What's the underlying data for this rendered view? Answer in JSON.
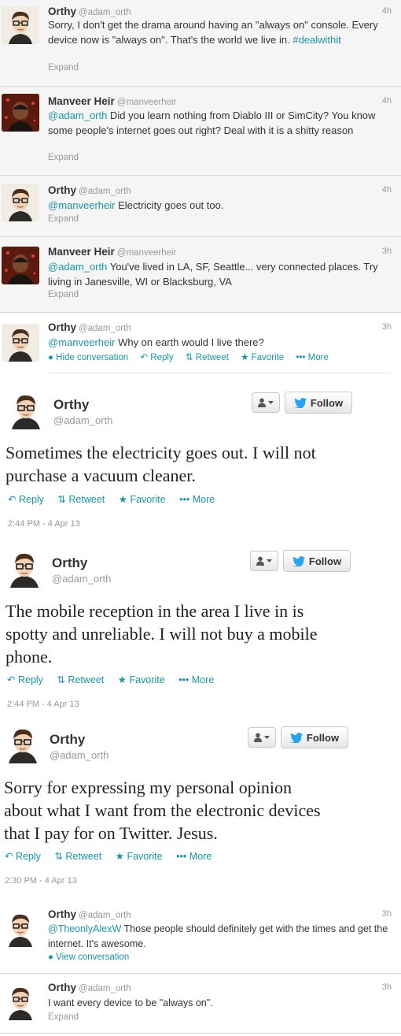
{
  "colors": {
    "link": "#1a94a6",
    "muted": "#999999",
    "text": "#333333"
  },
  "compact": [
    {
      "name": "Orthy",
      "handle": "@adam_orth",
      "time": "4h",
      "text_parts": [
        {
          "t": "Sorry, I don't get the drama around having an \"always on\" console. Every device now is \"always on\". That's the world we live in. "
        },
        {
          "t": "#dealwithit",
          "link": true
        }
      ],
      "footer": "Expand"
    },
    {
      "name": "Manveer Heir",
      "handle": "@manveerheir",
      "time": "4h",
      "text_parts": [
        {
          "t": "@adam_orth",
          "link": true
        },
        {
          "t": " Did you learn nothing from Diablo III or SimCity? You know some people's internet goes out right? Deal with it is a shitty reason"
        }
      ],
      "footer": "Expand"
    },
    {
      "name": "Orthy",
      "handle": "@adam_orth",
      "time": "4h",
      "text_parts": [
        {
          "t": "@manveerheir",
          "link": true
        },
        {
          "t": " Electricity goes out too."
        }
      ],
      "footer": "Expand"
    },
    {
      "name": "Manveer Heir",
      "handle": "@manveerheir",
      "time": "3h",
      "text_parts": [
        {
          "t": "@adam_orth",
          "link": true
        },
        {
          "t": " You've lived in LA, SF, Seattle... very connected places. Try living in Janesville, WI or Blacksburg, VA"
        }
      ],
      "footer": "Expand"
    },
    {
      "name": "Orthy",
      "handle": "@adam_orth",
      "time": "3h",
      "text_parts": [
        {
          "t": "@manveerheir",
          "link": true
        },
        {
          "t": " Why on earth would I live there?"
        }
      ],
      "actions": [
        "Hide conversation",
        "Reply",
        "Retweet",
        "Favorite",
        "More"
      ]
    }
  ],
  "expanded": [
    {
      "name": "Orthy",
      "handle": "@adam_orth",
      "follow": "Follow",
      "text": "Sometimes the electricity goes out. I will not purchase a vacuum cleaner.",
      "actions": [
        "Reply",
        "Retweet",
        "Favorite",
        "More"
      ],
      "stamp": "2:44 PM - 4 Apr 13"
    },
    {
      "name": "Orthy",
      "handle": "@adam_orth",
      "follow": "Follow",
      "text": "The mobile reception in the area I live in is spotty and unreliable. I will not buy a mobile phone.",
      "actions": [
        "Reply",
        "Retweet",
        "Favorite",
        "More"
      ],
      "stamp": "2:44 PM - 4 Apr 13"
    },
    {
      "name": "Orthy",
      "handle": "@adam_orth",
      "follow": "Follow",
      "text": "Sorry for expressing my personal opinion about what I want from the electronic devices that I pay for on Twitter. Jesus.",
      "actions": [
        "Reply",
        "Retweet",
        "Favorite",
        "More"
      ],
      "stamp": "2:30 PM - 4 Apr 13"
    }
  ],
  "tail": [
    {
      "name": "Orthy",
      "handle": "@adam_orth",
      "time": "3h",
      "text_parts": [
        {
          "t": "@TheonlyAlexW",
          "link": true
        },
        {
          "t": " Those people should definitely get with the times and get the internet. It's awesome."
        }
      ],
      "footer_link": "View conversation"
    },
    {
      "name": "Orthy",
      "handle": "@adam_orth",
      "time": "3h",
      "text_parts": [
        {
          "t": "I want every device to be \"always on\"."
        }
      ],
      "footer": "Expand"
    }
  ]
}
